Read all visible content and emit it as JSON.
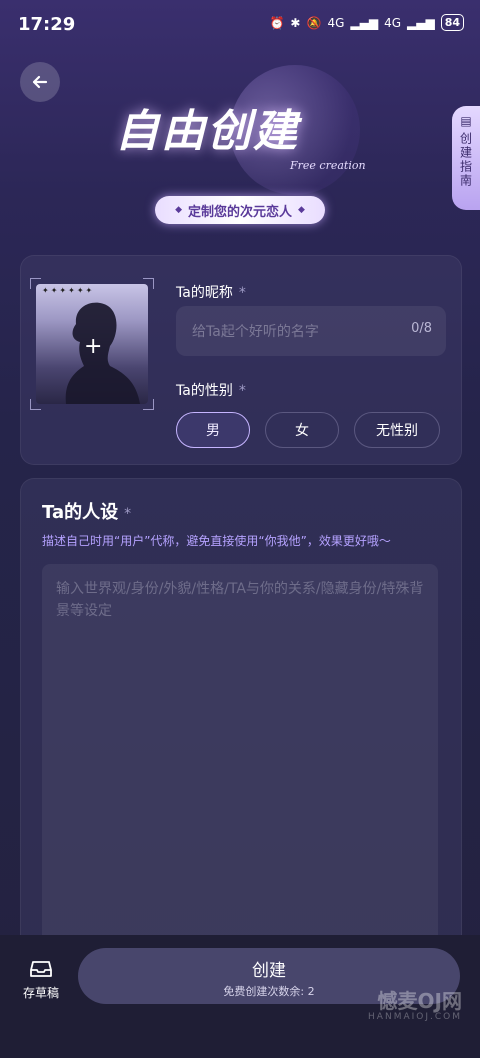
{
  "status_bar": {
    "time": "17:29",
    "battery": "84",
    "signal1": "4G",
    "signal2": "4G"
  },
  "header": {
    "title": "自由创建",
    "subtitle": "Free creation",
    "pill": "定制您的次元恋人",
    "guide_tab": "创建指南"
  },
  "profile": {
    "nickname_label": "Ta的昵称",
    "nickname_placeholder": "给Ta起个好听的名字",
    "nickname_count": "0/8",
    "gender_label": "Ta的性别",
    "genders": [
      "男",
      "女",
      "无性别"
    ],
    "selected_gender": "男",
    "required_mark": "*"
  },
  "persona": {
    "title": "Ta的人设",
    "hint": "描述自己时用“用户”代称，避免直接使用“你我他”，效果更好哦～",
    "placeholder": "输入世界观/身份/外貌/性格/TA与你的关系/隐藏身份/特殊背景等设定"
  },
  "bottom": {
    "draft_label": "存草稿",
    "create_label": "创建",
    "create_sub": "免费创建次数余: 2"
  },
  "watermark": {
    "text": "憾麦OJ网",
    "sub": "HANMAIOJ.COM"
  },
  "colors": {
    "accent": "#c6b5ff",
    "hint": "#b5a2ff",
    "background": "#25244a"
  }
}
